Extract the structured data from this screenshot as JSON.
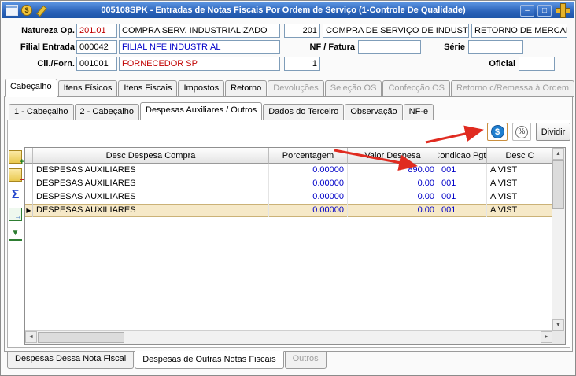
{
  "window": {
    "title": "005108SPK - Entradas de Notas Fiscais Por Ordem de Serviço (1-Controle De Qualidade)",
    "minimize_glyph": "–",
    "maximize_glyph": "□"
  },
  "titlebar_icons": {
    "money_glyph": "$"
  },
  "header": {
    "natureza_op": {
      "label": "Natureza Op.",
      "code": "201.01",
      "desc": "COMPRA SERV. INDUSTRIALIZADO",
      "code2": "201",
      "desc2": "COMPRA DE SERVIÇO DE INDUSTRIAL",
      "desc3": "RETORNO DE MERCAD"
    },
    "filial": {
      "label": "Filial Entrada",
      "code": "000042",
      "desc": "FILIAL NFE INDUSTRIAL"
    },
    "nf_fatura": {
      "label": "NF / Fatura",
      "value": ""
    },
    "serie": {
      "label": "Série",
      "value": ""
    },
    "cli_forn": {
      "label": "Cli./Forn.",
      "code": "001001",
      "desc": "FORNECEDOR SP",
      "qty": "1"
    },
    "oficial": {
      "label": "Oficial",
      "value": ""
    }
  },
  "tabs_main": {
    "items": [
      {
        "label": "Cabeçalho"
      },
      {
        "label": "Itens Físicos"
      },
      {
        "label": "Itens Fiscais"
      },
      {
        "label": "Impostos"
      },
      {
        "label": "Retorno"
      },
      {
        "label": "Devoluções"
      },
      {
        "label": "Seleção OS"
      },
      {
        "label": "Confecção OS"
      },
      {
        "label": "Retorno c/Remessa à Ordem"
      }
    ]
  },
  "tabs_sub": {
    "items": [
      {
        "label": "1 - Cabeçalho"
      },
      {
        "label": "2 - Cabeçalho"
      },
      {
        "label": "Despesas Auxiliares / Outros"
      },
      {
        "label": "Dados do Terceiro"
      },
      {
        "label": "Observação"
      },
      {
        "label": "NF-e"
      }
    ]
  },
  "toolbar": {
    "dollar_glyph": "$",
    "percent_glyph": "%",
    "divide_label": "Dividir"
  },
  "sidebar_icons": {
    "add_glyph": "+",
    "remove_glyph": "−",
    "sum_glyph": "Σ",
    "export_glyph": "→",
    "last_glyph": "▼"
  },
  "grid": {
    "columns": [
      "Desc Despesa Compra",
      "Porcentagem",
      "Valor Despesa",
      "Condicao Pgto",
      "Desc C"
    ],
    "rows": [
      {
        "desc": "DESPESAS AUXILIARES",
        "pct": "0.00000",
        "val": "890.00",
        "cond": "001",
        "cond_desc": "A VIST"
      },
      {
        "desc": "DESPESAS AUXILIARES",
        "pct": "0.00000",
        "val": "0.00",
        "cond": "001",
        "cond_desc": "A VIST"
      },
      {
        "desc": "DESPESAS AUXILIARES",
        "pct": "0.00000",
        "val": "0.00",
        "cond": "001",
        "cond_desc": "A VIST"
      },
      {
        "desc": "DESPESAS AUXILIARES",
        "pct": "0.00000",
        "val": "0.00",
        "cond": "001",
        "cond_desc": "A VIST"
      }
    ],
    "selected_row_glyph": "▶"
  },
  "scrollbars": {
    "up": "▲",
    "down": "▼",
    "left": "◄",
    "right": "►"
  },
  "tabs_bottom": {
    "items": [
      {
        "label": "Despesas Dessa Nota Fiscal"
      },
      {
        "label": "Despesas de Outras Notas Fiscais"
      },
      {
        "label": "Outros"
      }
    ]
  },
  "colors": {
    "title_gradient_top": "#5a93e0",
    "title_gradient_bottom": "#1d55a8",
    "accent_blue": "#1f7fd0",
    "value_blue": "#0000c8",
    "value_red": "#c00000",
    "selected_row": "#f6e9c8",
    "annotation_red": "#e02b20",
    "gold": "#e6b32a"
  }
}
